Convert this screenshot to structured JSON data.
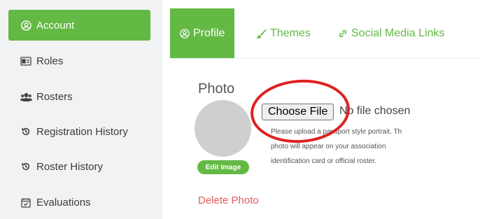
{
  "sidebar": {
    "items": [
      {
        "label": "Account",
        "icon": "user-circle-icon"
      },
      {
        "label": "Roles",
        "icon": "id-card-icon"
      },
      {
        "label": "Rosters",
        "icon": "users-icon"
      },
      {
        "label": "Registration History",
        "icon": "history-icon"
      },
      {
        "label": "Roster History",
        "icon": "history-icon"
      },
      {
        "label": "Evaluations",
        "icon": "calendar-check-icon"
      }
    ]
  },
  "tabs": [
    {
      "label": "Profile",
      "icon": "user-circle-icon"
    },
    {
      "label": "Themes",
      "icon": "brush-icon"
    },
    {
      "label": "Social Media Links",
      "icon": "link-icon"
    }
  ],
  "photo": {
    "title": "Photo",
    "edit_label": "Edit Image",
    "choose_file_label": "Choose File",
    "no_file_text": "No file chosen",
    "help_line1": "Please upload a passport style portrait. Th",
    "help_line2": "photo will appear on your association",
    "help_line3": "identification card or official roster.",
    "delete_label": "Delete Photo"
  },
  "colors": {
    "accent": "#63b944",
    "delete": "#e15d5d",
    "highlight": "#e02020",
    "sidebar_bg": "#f1f2f4"
  }
}
